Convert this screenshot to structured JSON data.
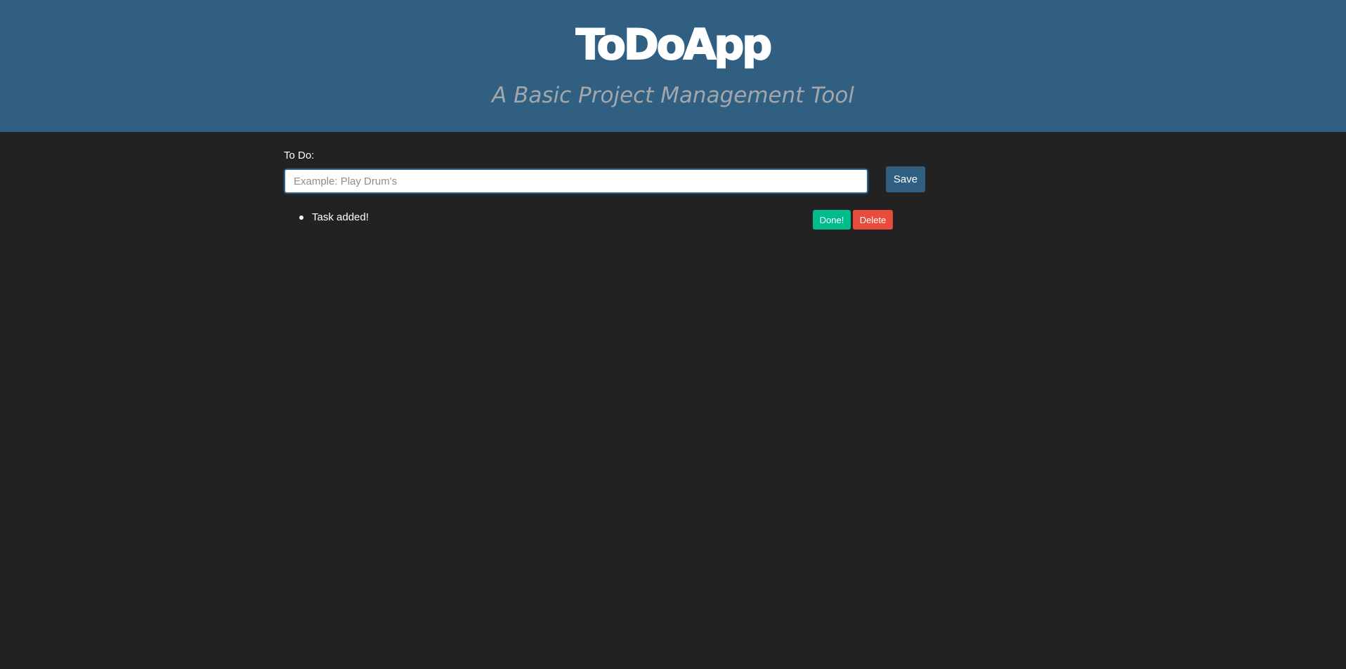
{
  "header": {
    "title": "ToDoApp",
    "subtitle": "A Basic Project Management Tool"
  },
  "form": {
    "label": "To Do:",
    "input_value": "",
    "input_placeholder": "Example: Play Drum's",
    "save_label": "Save"
  },
  "tasks": [
    {
      "text": "Task added!",
      "done_label": "Done!",
      "delete_label": "Delete"
    }
  ],
  "colors": {
    "header_bg": "#305f82",
    "page_bg": "#222222",
    "done": "#00bc8c",
    "delete": "#e74c3c"
  }
}
